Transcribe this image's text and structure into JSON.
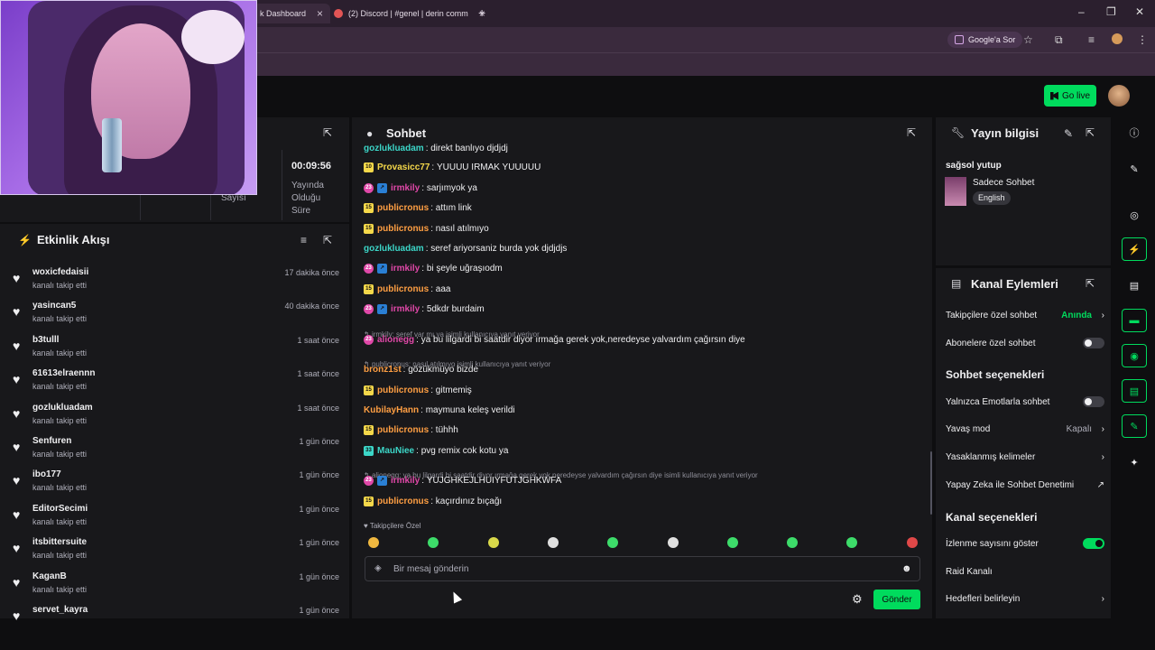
{
  "browser": {
    "tabs": [
      {
        "label": "k Dashboard"
      },
      {
        "label": "(2) Discord | #genel | derin comm"
      }
    ],
    "google_btn": "Google'a Sor"
  },
  "topbar": {
    "go_live": "Go live"
  },
  "stats": {
    "timer": "00:09:56",
    "timer_label1": "Yayında",
    "timer_label2": "Olduğu",
    "timer_label3": "Süre",
    "partial_label": "Sayısı"
  },
  "feed": {
    "title": "Etkinlik Akışı",
    "items": [
      {
        "name": "woxicfedaisii",
        "desc": "kanalı takip etti",
        "time": "17 dakika önce"
      },
      {
        "name": "yasincan5",
        "desc": "kanalı takip etti",
        "time": "40 dakika önce"
      },
      {
        "name": "b3tulll",
        "desc": "kanalı takip etti",
        "time": "1 saat önce"
      },
      {
        "name": "61613elraennn",
        "desc": "kanalı takip etti",
        "time": "1 saat önce"
      },
      {
        "name": "gozlukluadam",
        "desc": "kanalı takip etti",
        "time": "1 saat önce"
      },
      {
        "name": "Senfuren",
        "desc": "kanalı takip etti",
        "time": "1 gün önce"
      },
      {
        "name": "ibo177",
        "desc": "kanalı takip etti",
        "time": "1 gün önce"
      },
      {
        "name": "EditorSecimi",
        "desc": "kanalı takip etti",
        "time": "1 gün önce"
      },
      {
        "name": "itsbittersuite",
        "desc": "kanalı takip etti",
        "time": "1 gün önce"
      },
      {
        "name": "KaganB",
        "desc": "kanalı takip etti",
        "time": "1 gün önce"
      },
      {
        "name": "servet_kayra",
        "desc": "",
        "time": "1 gün önce"
      }
    ]
  },
  "chat": {
    "title": "Sohbet",
    "messages": [
      {
        "user": "gozlukluadam",
        "color": "#3cd6c8",
        "badges": [],
        "text": "direkt banlıyo djdjdj"
      },
      {
        "user": "Provasicc77",
        "color": "#f5d84a",
        "badges": [
          "yel"
        ],
        "badge_text": "10",
        "text": "YUUUU IRMAK YUUUUU"
      },
      {
        "user": "irmkily",
        "color": "#e048a8",
        "badges": [
          "pink",
          "blue"
        ],
        "text": "sarjımyok ya"
      },
      {
        "user": "publicronus",
        "color": "#ff9f43",
        "badges": [
          "yel"
        ],
        "text": "attım link"
      },
      {
        "user": "publicronus",
        "color": "#ff9f43",
        "badges": [
          "yel"
        ],
        "text": "nasıl atılmıyo"
      },
      {
        "user": "gozlukluadam",
        "color": "#3cd6c8",
        "badges": [],
        "text": "seref ariyorsaniz burda yok djdjdjs"
      },
      {
        "user": "irmkily",
        "color": "#e048a8",
        "badges": [
          "pink",
          "blue"
        ],
        "text": "bi şeyle uğraşıodm"
      },
      {
        "user": "publicronus",
        "color": "#ff9f43",
        "badges": [
          "yel"
        ],
        "text": "aaa"
      },
      {
        "user": "irmkily",
        "color": "#e048a8",
        "badges": [
          "pink",
          "blue"
        ],
        "text": "5dkdr burdaim"
      },
      {
        "reply": "irmkily: şeref var mı ya isimli kullanıcıya yanıt veriyor"
      },
      {
        "user": "alionegg",
        "color": "#e048a8",
        "badges": [
          "pink"
        ],
        "text": "ya bu lilgardi bi saatdir diyor ırmağa gerek yok,neredeyse yalvardım çağırsın diye"
      },
      {
        "reply": "publicronus: nasıl atılmıyo isimli kullanıcıya yanıt veriyor"
      },
      {
        "user": "bronz1st",
        "color": "#ff9f43",
        "badges": [],
        "text": "gözükmüyo bizde"
      },
      {
        "user": "publicronus",
        "color": "#ff9f43",
        "badges": [
          "yel"
        ],
        "text": "gitmemiş"
      },
      {
        "user": "KubilayHann",
        "color": "#ff9f43",
        "badges": [],
        "text": "maymuna keleş verildi"
      },
      {
        "user": "publicronus",
        "color": "#ff9f43",
        "badges": [
          "yel"
        ],
        "text": "tühhh"
      },
      {
        "user": "MauNiee",
        "color": "#3cd6c8",
        "badges": [
          "teal"
        ],
        "text": "pvg remix cok kotu ya"
      },
      {
        "reply": "alionegg: ya bu lilgardi bi saatdir diyor ırmağa gerek yok,neredeyse yalvardım çağırsın diye isimli kullanıcıya yanıt veriyor"
      },
      {
        "user": "irmkily",
        "color": "#e048a8",
        "badges": [
          "pink",
          "blue"
        ],
        "text": "YUJGHKEJLHUIYFUTJGHKWFA"
      },
      {
        "user": "publicronus",
        "color": "#ff9f43",
        "badges": [
          "yel"
        ],
        "text": "kaçırdınız bıçağı"
      }
    ],
    "followers_only": "Takipçilere Özel",
    "input_placeholder": "Bir mesaj gönderin",
    "send": "Gönder"
  },
  "stream_info": {
    "title": "Yayın bilgisi",
    "stream_title": "sağsol yutup",
    "category": "Sadece Sohbet",
    "language": "English"
  },
  "channel_actions": {
    "title": "Kanal Eylemleri",
    "followers_chat": "Takipçilere özel sohbet",
    "followers_chat_value": "Anında",
    "subs_chat": "Abonelere özel sohbet",
    "chat_options": "Sohbet seçenekleri",
    "emote_only": "Yalnızca Emotlarla sohbet",
    "slow_mode": "Yavaş mod",
    "slow_mode_value": "Kapalı",
    "banned_words": "Yasaklanmış kelimeler",
    "ai_moderation": "Yapay Zeka ile Sohbet Denetimi",
    "channel_options": "Kanal seçenekleri",
    "show_viewers": "İzlenme sayısını göster",
    "raid": "Raid Kanalı",
    "goals": "Hedefleri belirleyin"
  },
  "colors": {
    "accent": "#00db5d",
    "panel": "#18181b",
    "bg": "#0e0e10"
  }
}
